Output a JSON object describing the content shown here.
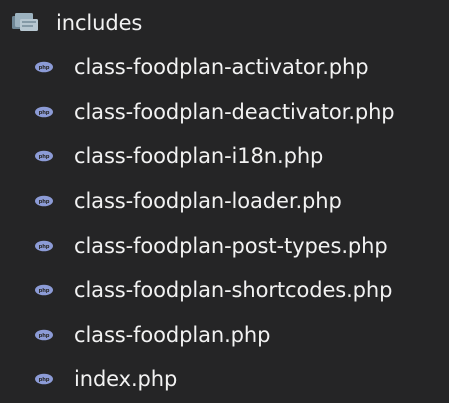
{
  "explorer": {
    "folder": {
      "name": "includes",
      "icon": "folder-open-icon"
    },
    "files": [
      {
        "name": "class-foodplan-activator.php",
        "icon": "php-file-icon"
      },
      {
        "name": "class-foodplan-deactivator.php",
        "icon": "php-file-icon"
      },
      {
        "name": "class-foodplan-i18n.php",
        "icon": "php-file-icon"
      },
      {
        "name": "class-foodplan-loader.php",
        "icon": "php-file-icon"
      },
      {
        "name": "class-foodplan-post-types.php",
        "icon": "php-file-icon"
      },
      {
        "name": "class-foodplan-shortcodes.php",
        "icon": "php-file-icon"
      },
      {
        "name": "class-foodplan.php",
        "icon": "php-file-icon"
      },
      {
        "name": "index.php",
        "icon": "php-file-icon"
      }
    ]
  },
  "colors": {
    "background": "#252526",
    "text": "#f2f2f2",
    "folder_icon": "#8aa4b3",
    "php_icon": "#8c9bd6"
  }
}
